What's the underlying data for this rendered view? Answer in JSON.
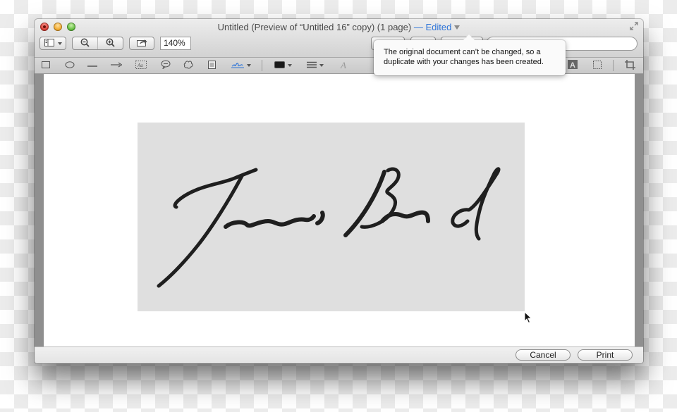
{
  "window": {
    "title_main": "Untitled (Preview of “Untitled 16” copy) (1 page)",
    "title_status": "— Edited",
    "accent_color": "#2d74d8"
  },
  "toolbar": {
    "sidebar_icon": "sidebar-icon",
    "zoom_out_icon": "zoom-out-icon",
    "zoom_in_icon": "zoom-in-icon",
    "share_icon": "share-icon",
    "zoom_level": "140%",
    "search_placeholder": ""
  },
  "markup_tools": [
    {
      "name": "rectangle-tool",
      "glyph": "□"
    },
    {
      "name": "oval-tool",
      "glyph": "◯"
    },
    {
      "name": "line-tool",
      "glyph": "—"
    },
    {
      "name": "arrow-tool",
      "glyph": "→"
    },
    {
      "name": "text-box-tool",
      "glyph": "Aa"
    },
    {
      "name": "speech-bubble-tool",
      "glyph": "💬"
    },
    {
      "name": "thought-bubble-tool",
      "glyph": "☁"
    },
    {
      "name": "note-tool",
      "glyph": "▤"
    },
    {
      "name": "signature-tool",
      "glyph": "S"
    },
    {
      "name": "color-tool",
      "glyph": "■"
    },
    {
      "name": "line-style-tool",
      "glyph": "≡"
    },
    {
      "name": "font-tool",
      "glyph": "A"
    },
    {
      "name": "text-style-tool",
      "glyph": "A"
    },
    {
      "name": "selection-tool",
      "glyph": "⬚"
    },
    {
      "name": "crop-tool",
      "glyph": "⌗"
    }
  ],
  "popover": {
    "message_line1": "The original document can’t be changed, so a",
    "message_line2": "duplicate with your changes has been created."
  },
  "document": {
    "signature_text": "James Bond"
  },
  "footer": {
    "cancel_label": "Cancel",
    "print_label": "Print"
  }
}
